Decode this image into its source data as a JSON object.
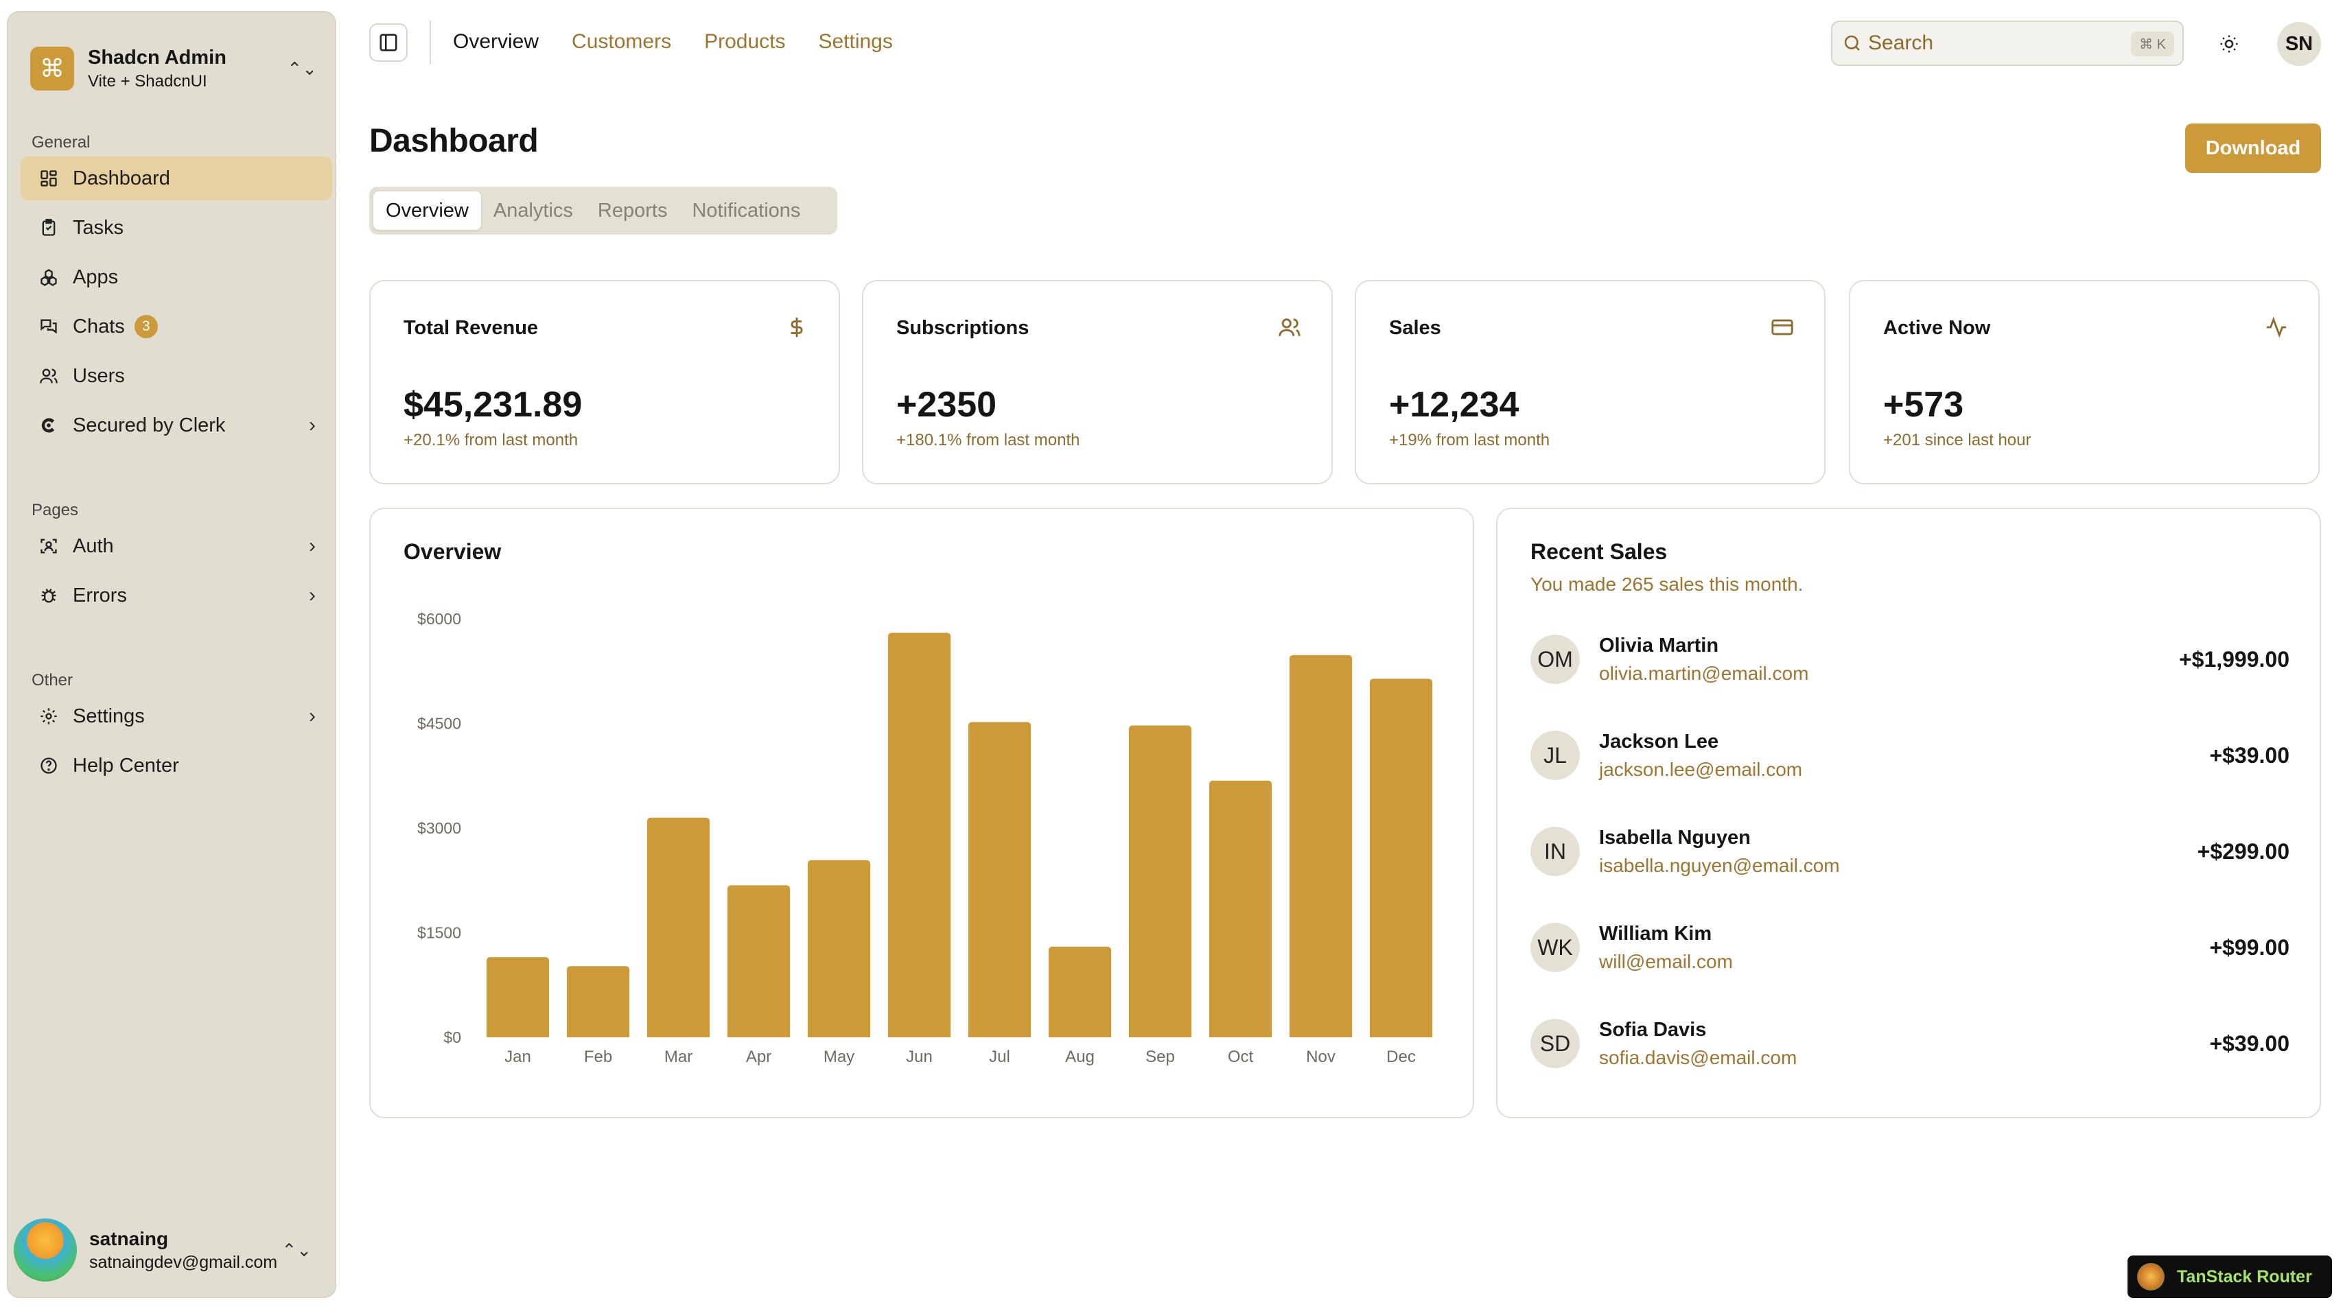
{
  "sidebar": {
    "brand_title": "Shadcn Admin",
    "brand_subtitle": "Vite + ShadcnUI",
    "groups": {
      "general": "General",
      "pages": "Pages",
      "other": "Other"
    },
    "items": {
      "dashboard": "Dashboard",
      "tasks": "Tasks",
      "apps": "Apps",
      "chats": "Chats",
      "chats_badge": "3",
      "users": "Users",
      "clerk": "Secured by Clerk",
      "auth": "Auth",
      "errors": "Errors",
      "settings": "Settings",
      "help": "Help Center"
    },
    "user": {
      "name": "satnaing",
      "email": "satnaingdev@gmail.com"
    }
  },
  "topbar": {
    "nav": [
      "Overview",
      "Customers",
      "Products",
      "Settings"
    ],
    "search_placeholder": "Search",
    "search_kbd": "⌘ K",
    "avatar_initials": "SN"
  },
  "page": {
    "title": "Dashboard",
    "download_label": "Download",
    "tabs": [
      "Overview",
      "Analytics",
      "Reports",
      "Notifications"
    ]
  },
  "stats": [
    {
      "label": "Total Revenue",
      "value": "$45,231.89",
      "delta": "+20.1% from last month",
      "icon": "dollar-icon"
    },
    {
      "label": "Subscriptions",
      "value": "+2350",
      "delta": "+180.1% from last month",
      "icon": "users-icon"
    },
    {
      "label": "Sales",
      "value": "+12,234",
      "delta": "+19% from last month",
      "icon": "credit-card-icon"
    },
    {
      "label": "Active Now",
      "value": "+573",
      "delta": "+201 since last hour",
      "icon": "activity-icon"
    }
  ],
  "overview_title": "Overview",
  "chart_data": {
    "type": "bar",
    "title": "Overview",
    "categories": [
      "Jan",
      "Feb",
      "Mar",
      "Apr",
      "May",
      "Jun",
      "Jul",
      "Aug",
      "Sep",
      "Oct",
      "Nov",
      "Dec"
    ],
    "values": [
      1150,
      1020,
      3150,
      2180,
      2540,
      5800,
      4520,
      1300,
      4470,
      3680,
      5480,
      5140
    ],
    "yticks": [
      "$0",
      "$1500",
      "$3000",
      "$4500",
      "$6000"
    ],
    "ylim": [
      0,
      6000
    ],
    "color": "#cc9a38"
  },
  "recent_sales": {
    "title": "Recent Sales",
    "subtitle": "You made 265 sales this month.",
    "items": [
      {
        "initials": "OM",
        "name": "Olivia Martin",
        "email": "olivia.martin@email.com",
        "amount": "+$1,999.00"
      },
      {
        "initials": "JL",
        "name": "Jackson Lee",
        "email": "jackson.lee@email.com",
        "amount": "+$39.00"
      },
      {
        "initials": "IN",
        "name": "Isabella Nguyen",
        "email": "isabella.nguyen@email.com",
        "amount": "+$299.00"
      },
      {
        "initials": "WK",
        "name": "William Kim",
        "email": "will@email.com",
        "amount": "+$99.00"
      },
      {
        "initials": "SD",
        "name": "Sofia Davis",
        "email": "sofia.davis@email.com",
        "amount": "+$39.00"
      }
    ]
  },
  "devtools": {
    "label": "TanStack Router"
  },
  "colors": {
    "accent": "#cc9a38",
    "sidebar_bg": "#e1ddd0",
    "active_item": "#e8d1a0",
    "muted_text": "#9d7530"
  }
}
